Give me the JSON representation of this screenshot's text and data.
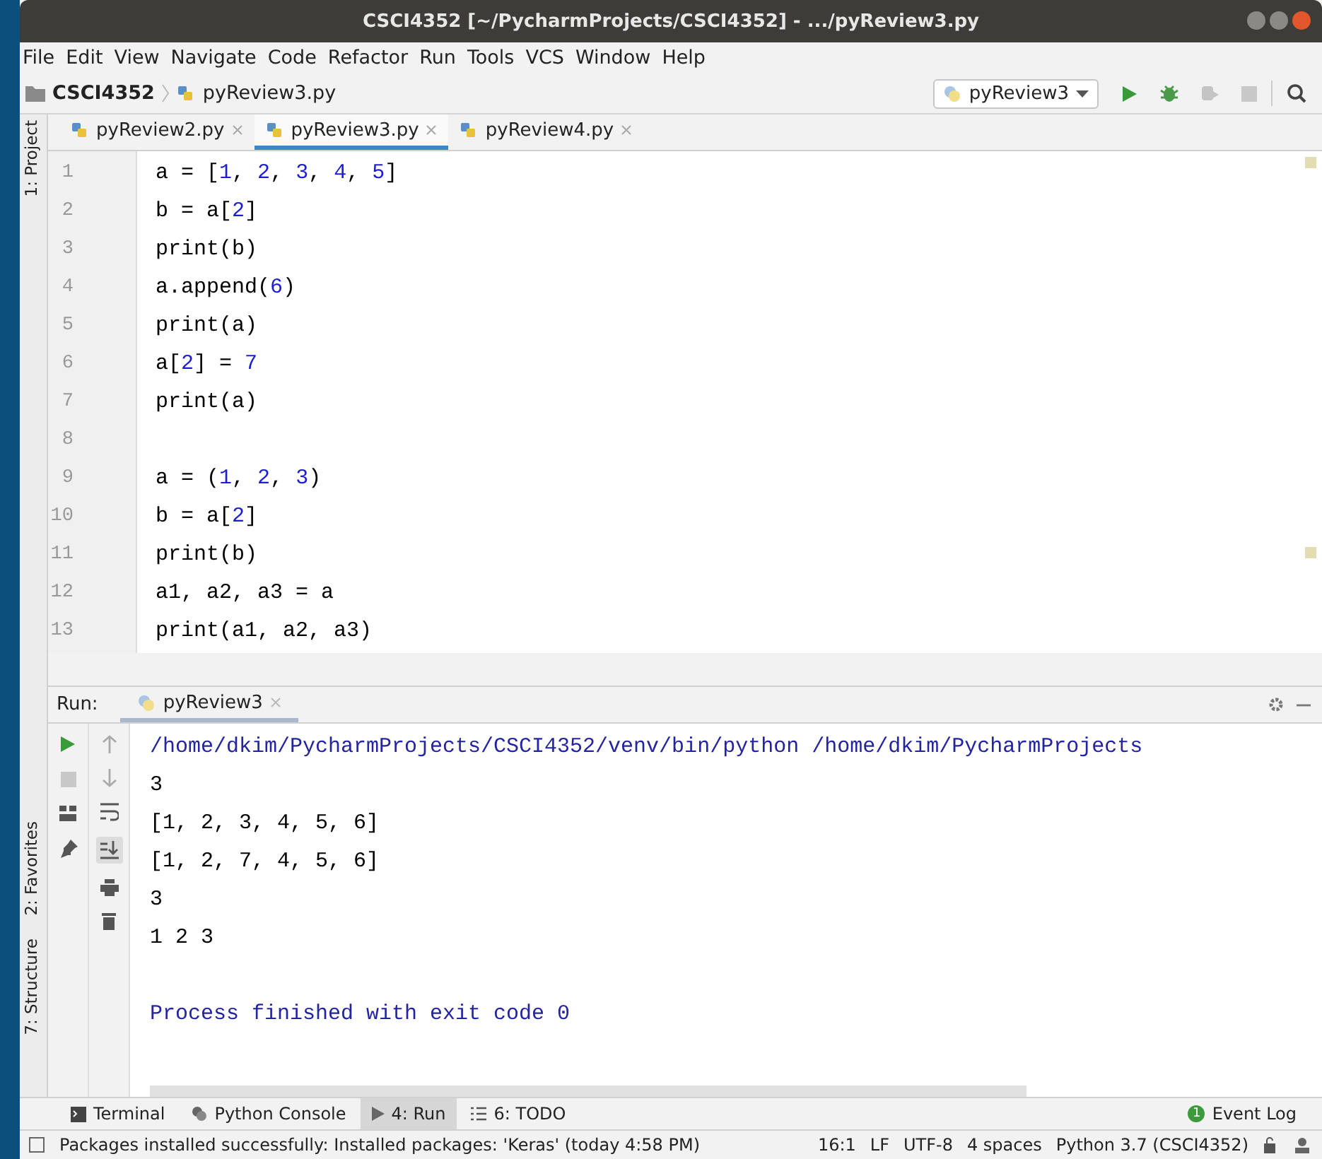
{
  "window": {
    "title": "CSCI4352 [~/PycharmProjects/CSCI4352] - .../pyReview3.py"
  },
  "menu": [
    "File",
    "Edit",
    "View",
    "Navigate",
    "Code",
    "Refactor",
    "Run",
    "Tools",
    "VCS",
    "Window",
    "Help"
  ],
  "breadcrumbs": {
    "project": "CSCI4352",
    "file": "pyReview3.py"
  },
  "run_config": {
    "label": "pyReview3"
  },
  "left_tool_strip": [
    {
      "label": "1: Project"
    },
    {
      "label": "2: Favorites"
    },
    {
      "label": "7: Structure"
    }
  ],
  "editor_tabs": [
    {
      "label": "pyReview2.py",
      "selected": false
    },
    {
      "label": "pyReview3.py",
      "selected": true
    },
    {
      "label": "pyReview4.py",
      "selected": false
    }
  ],
  "code_lines": [
    {
      "number": "1",
      "text": "a = [1, 2, 3, 4, 5]"
    },
    {
      "number": "2",
      "text": "b = a[2]"
    },
    {
      "number": "3",
      "text": "print(b)"
    },
    {
      "number": "4",
      "text": "a.append(6)"
    },
    {
      "number": "5",
      "text": "print(a)"
    },
    {
      "number": "6",
      "text": "a[2] = 7"
    },
    {
      "number": "7",
      "text": "print(a)"
    },
    {
      "number": "8"
    },
    {
      "number": "9",
      "text": "a = (1, 2, 3)"
    },
    {
      "number": "10",
      "text": "b = a[2]"
    },
    {
      "number": "11",
      "text": "print(b)"
    },
    {
      "number": "12",
      "text": "a1, a2, a3 = a"
    },
    {
      "number": "13",
      "text": "print(a1, a2, a3)"
    }
  ],
  "run_panel": {
    "label": "Run:",
    "tab": "pyReview3",
    "console": [
      {
        "kind": "command",
        "text": "/home/dkim/PycharmProjects/CSCI4352/venv/bin/python /home/dkim/PycharmProjects"
      },
      {
        "kind": "output",
        "text": "3"
      },
      {
        "kind": "output",
        "text": "[1, 2, 3, 4, 5, 6]"
      },
      {
        "kind": "output",
        "text": "[1, 2, 7, 4, 5, 6]"
      },
      {
        "kind": "output",
        "text": "3"
      },
      {
        "kind": "output",
        "text": "1 2 3"
      },
      {
        "kind": "status",
        "text": "Process finished with exit code 0"
      }
    ]
  },
  "tool_window_tabs": [
    {
      "kind": "terminal",
      "label": "Terminal",
      "selected": false
    },
    {
      "kind": "console",
      "label": "Python Console",
      "selected": false
    },
    {
      "kind": "run",
      "label": "4: Run",
      "selected": true
    },
    {
      "kind": "todo",
      "label": "6: TODO",
      "selected": false
    }
  ],
  "event_log": {
    "badge": "1",
    "label": "Event Log"
  },
  "status_bar": {
    "message": "Packages installed successfully: Installed packages: 'Keras' (today 4:58 PM)",
    "items": [
      "16:1",
      "LF",
      "UTF-8",
      "4 spaces",
      "Python 3.7 (CSCI4352)"
    ]
  }
}
